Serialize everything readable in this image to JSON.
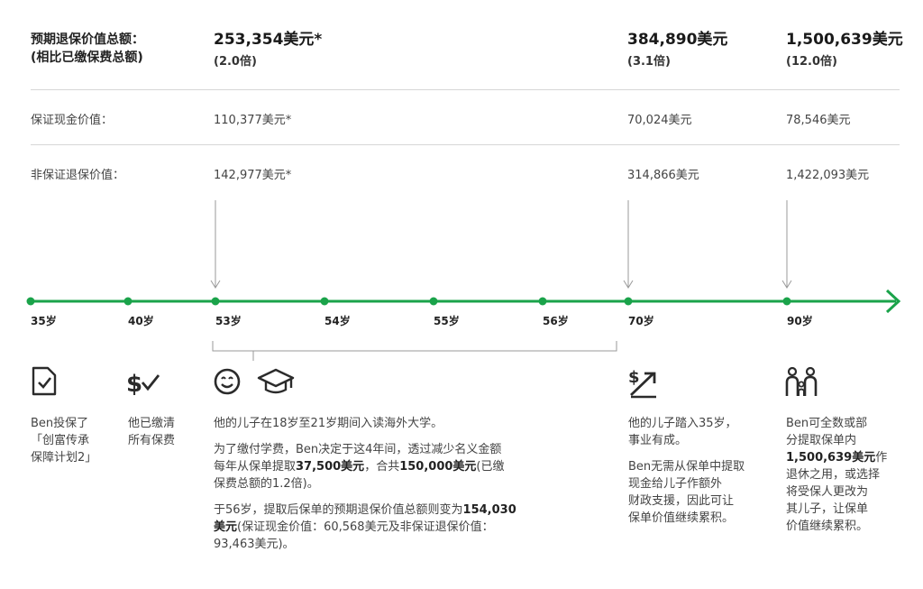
{
  "header": {
    "label_line1": "预期退保价值总额：",
    "label_line2": "(相比已缴保费总额)",
    "col53": {
      "value": "253,354美元*",
      "multiple": "(2.0倍)"
    },
    "col70": {
      "value": "384,890美元",
      "multiple": "(3.1倍)"
    },
    "col90": {
      "value": "1,500,639美元",
      "multiple": "(12.0倍)"
    }
  },
  "rows": {
    "guaranteed": {
      "label": "保证现金价值：",
      "col53": "110,377美元*",
      "col70": "70,024美元",
      "col90": "78,546美元"
    },
    "non_guaranteed": {
      "label": "非保证退保价值：",
      "col53": "142,977美元*",
      "col70": "314,866美元",
      "col90": "1,422,093美元"
    }
  },
  "timeline": {
    "color": "#1aa34a",
    "ages": [
      "35岁",
      "40岁",
      "53岁",
      "54岁",
      "55岁",
      "56岁",
      "70岁",
      "90岁"
    ]
  },
  "events": {
    "e35": {
      "icon": "document-check-icon",
      "text1": "Ben投保了",
      "text2": "「创富传承",
      "text3": "保障计划2」"
    },
    "e40": {
      "icon": "dollar-check-icon",
      "text1": "他已缴清",
      "text2": "所有保费"
    },
    "e53": {
      "icons": [
        "smiley-icon",
        "graduation-cap-icon"
      ],
      "p1": "他的儿子在18岁至21岁期间入读海外大学。",
      "p2_a": "为了缴付学费，Ben决定于这4年间，透过减少名义金额",
      "p2_b": "每年从保单提取",
      "p2_amount1": "37,500美元",
      "p2_c": "，合共",
      "p2_amount2": "150,000美元",
      "p2_d": "(已缴",
      "p2_e": "保费总额的1.2倍)。",
      "p3_a": "于56岁，提取后保单的预期退保价值总额则变为",
      "p3_amount1": "154,030",
      "p3_amount2": "美元",
      "p3_b": "(保证现金价值：60,568美元及非保证退保价值：",
      "p3_c": "93,463美元)。"
    },
    "e70": {
      "icon": "growth-dollar-icon",
      "p1_a": "他的儿子踏入35岁，",
      "p1_b": "事业有成。",
      "p2_a": "Ben无需从保单中提取",
      "p2_b": "现金给儿子作额外",
      "p2_c": "财政支援，因此可让",
      "p2_d": "保单价值继续累积。"
    },
    "e90": {
      "icon": "family-icon",
      "l1": "Ben可全数或部",
      "l2": "分提取保单内",
      "l3_amount": "1,500,639美元",
      "l3_b": "作",
      "l4": "退休之用，或选择",
      "l5": "将受保人更改为",
      "l6": "其儿子，让保单",
      "l7": "价值继续累积。"
    }
  }
}
